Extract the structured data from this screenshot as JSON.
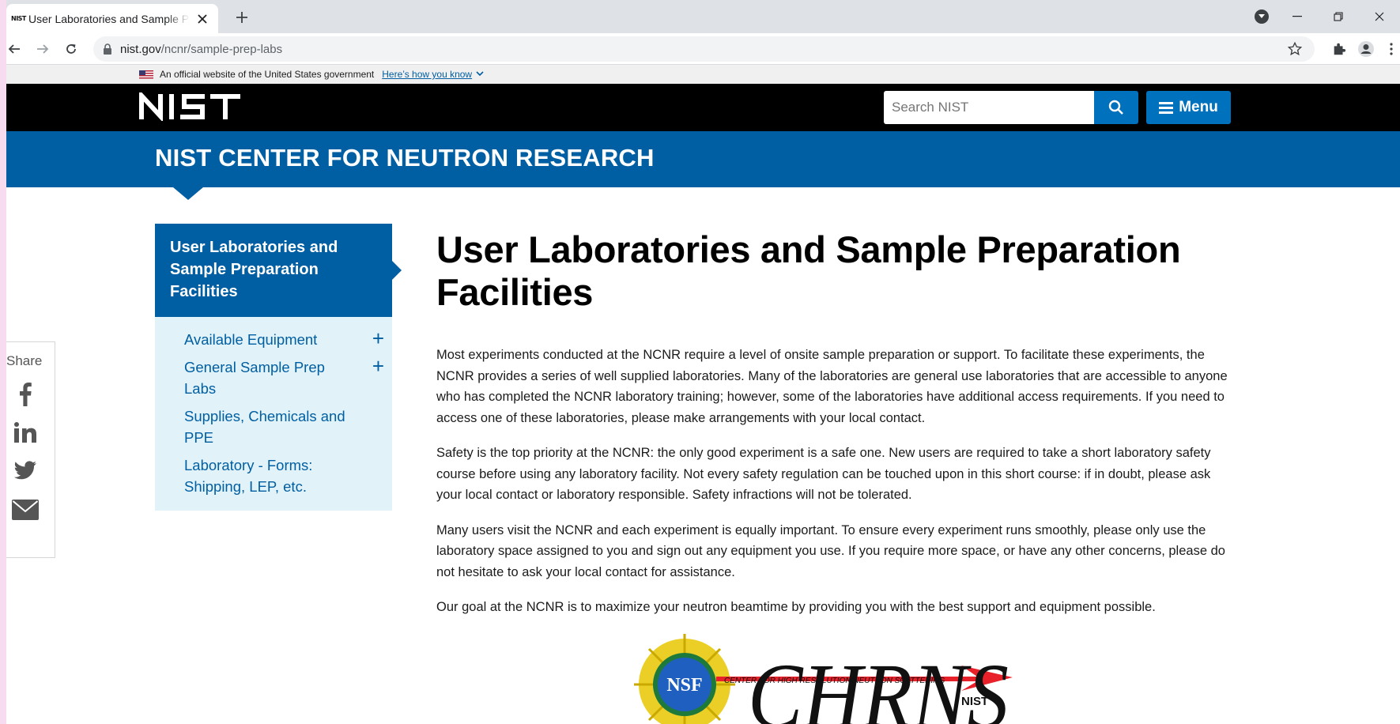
{
  "browser": {
    "tab": {
      "favicon": "NIST",
      "title": "User Laboratories and Sample Prep Labs",
      "close_icon": "close-icon"
    },
    "new_tab_icon": "plus-icon",
    "url": {
      "host": "nist.gov",
      "path": "/ncnr/sample-prep-labs"
    }
  },
  "gov_banner": {
    "text": "An official website of the United States government",
    "link": "Here’s how you know"
  },
  "header": {
    "logo": "NIST",
    "search_placeholder": "Search NIST",
    "menu_label": "Menu"
  },
  "org_title": "NIST CENTER FOR NEUTRON RESEARCH",
  "sidenav": {
    "heading": "User Laboratories and Sample Preparation Facilities",
    "items": [
      {
        "label": "Available Equipment",
        "expandable": true
      },
      {
        "label": "General Sample Prep Labs",
        "expandable": true
      },
      {
        "label": "Supplies, Chemicals and PPE",
        "expandable": false
      },
      {
        "label": "Laboratory - Forms: Shipping, LEP, etc.",
        "expandable": false
      }
    ]
  },
  "share": {
    "label": "Share",
    "icons": [
      "facebook-icon",
      "linkedin-icon",
      "twitter-icon",
      "email-icon"
    ]
  },
  "main": {
    "title": "User Laboratories and Sample Preparation Facilities",
    "paragraphs": [
      "Most experiments conducted at the NCNR require a level of onsite sample preparation or support. To facilitate these experiments, the NCNR provides a series of well supplied laboratories. Many of the laboratories are general use laboratories that are accessible to anyone who has completed the NCNR laboratory training; however, some of the laboratories have additional access requirements. If you need to access one of these laboratories, please make arrangements with your local contact.",
      "Safety is the top priority at the NCNR: the only good experiment is a safe one. New users are required to take a short laboratory safety course before using any laboratory facility. Not every safety regulation can be touched upon in this short course: if in doubt, please ask your local contact or laboratory responsible. Safety infractions will not be tolerated.",
      "Many users visit the NCNR and each experiment is equally important. To ensure every experiment runs smoothly, please only use the laboratory space assigned to you and sign out any equipment you use. If you require more space, or have any other concerns, please do not hesitate to ask your local contact for assistance.",
      "Our goal at the NCNR is to maximize your neutron beamtime by providing you with the best support and equipment possible."
    ]
  },
  "chrns_logo": {
    "wordmark": "CHRNS",
    "tagline": "CENTER FOR HIGH RESOLUTION NEUTRON SCATTERING",
    "nsf": "NSF",
    "nist": "NIST"
  },
  "colors": {
    "nist_blue": "#005ea2",
    "light_blue": "#e1f3f8",
    "black": "#000000"
  }
}
